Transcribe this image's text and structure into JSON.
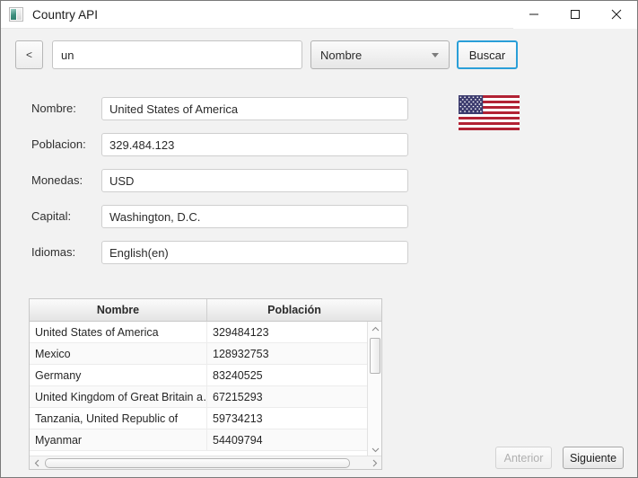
{
  "window": {
    "title": "Country API",
    "icon": "app-window-icon",
    "controls": {
      "minimize": "minimize-icon",
      "maximize": "maximize-icon",
      "close": "close-icon"
    }
  },
  "toolbar": {
    "back_label": "<",
    "search_value": "un",
    "search_placeholder": "",
    "filter_selected": "Nombre",
    "filter_options": [
      "Nombre"
    ],
    "search_button_label": "Buscar",
    "search_button_focus_color": "#2a9fd8"
  },
  "detail": {
    "fields": [
      {
        "label": "Nombre:",
        "value": "United States of America"
      },
      {
        "label": "Poblacion:",
        "value": "329.484.123"
      },
      {
        "label": "Monedas:",
        "value": "USD"
      },
      {
        "label": "Capital:",
        "value": "Washington, D.C."
      },
      {
        "label": "Idiomas:",
        "value": "English(en)"
      }
    ],
    "flag": {
      "name": "united-states-flag",
      "stripe_red": "#b22234",
      "stripe_white": "#ffffff",
      "canton_blue": "#3c3b6e"
    }
  },
  "table": {
    "columns": [
      "Nombre",
      "Población"
    ],
    "rows": [
      {
        "nombre": "United States of America",
        "poblacion": "329484123"
      },
      {
        "nombre": "Mexico",
        "poblacion": "128932753"
      },
      {
        "nombre": "Germany",
        "poblacion": "83240525"
      },
      {
        "nombre": "United Kingdom of Great Britain a…",
        "poblacion": "67215293"
      },
      {
        "nombre": "Tanzania, United Republic of",
        "poblacion": "59734213"
      },
      {
        "nombre": "Myanmar",
        "poblacion": "54409794"
      }
    ]
  },
  "pager": {
    "prev_label": "Anterior",
    "prev_enabled": false,
    "next_label": "Siguiente",
    "next_enabled": true
  }
}
